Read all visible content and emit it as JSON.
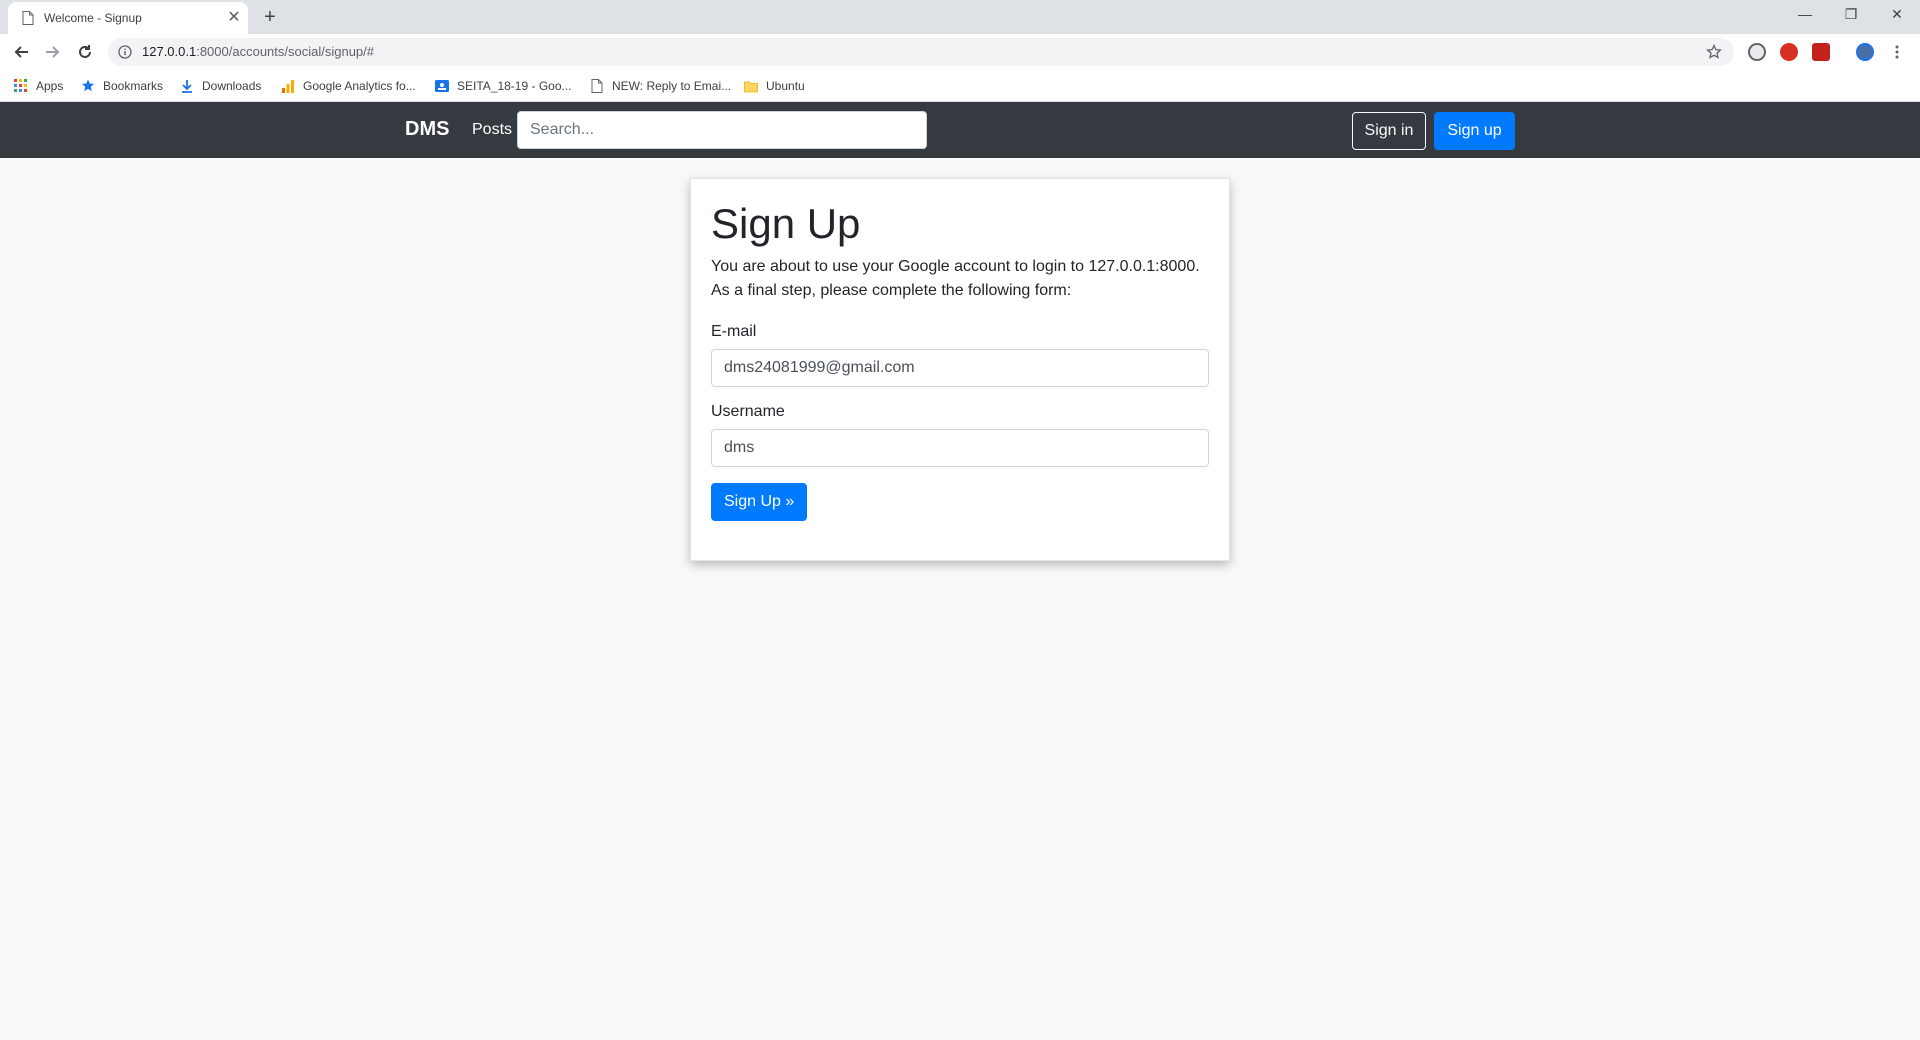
{
  "browser": {
    "tab_title": "Welcome - Signup",
    "url_host": "127.0.0.1",
    "url_rest": ":8000/accounts/social/signup/#",
    "bookmarks": [
      "Apps",
      "Bookmarks",
      "Downloads",
      "Google Analytics fo...",
      "SEITA_18-19 - Goo...",
      "NEW: Reply to Emai...",
      "Ubuntu"
    ]
  },
  "navbar": {
    "brand": "DMS",
    "posts": "Posts",
    "search_placeholder": "Search...",
    "signin": "Sign in",
    "signup": "Sign up"
  },
  "form": {
    "title": "Sign Up",
    "intro_line1": "You are about to use your Google account to login to 127.0.0.1:8000.",
    "intro_line2": "As a final step, please complete the following form:",
    "email_label": "E-mail",
    "email_value": "dms24081999@gmail.com",
    "username_label": "Username",
    "username_value": "dms",
    "submit": "Sign Up »"
  },
  "colors": {
    "navbar_bg": "#343a40",
    "primary": "#007bff",
    "page_bg": "#f8f9fa"
  }
}
